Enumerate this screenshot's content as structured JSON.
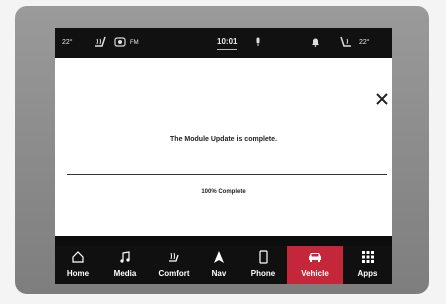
{
  "status_bar": {
    "temp_left": "22°",
    "radio_band": "FM",
    "clock": "10:01",
    "temp_right": "22°"
  },
  "dialog": {
    "message": "The Module Update is complete.",
    "progress_text": "100% Complete",
    "progress_percent": 100
  },
  "nav": {
    "items": [
      {
        "label": "Home",
        "icon": "home-icon"
      },
      {
        "label": "Media",
        "icon": "music-note-icon"
      },
      {
        "label": "Comfort",
        "icon": "seat-heat-icon"
      },
      {
        "label": "Nav",
        "icon": "navigation-arrow-icon"
      },
      {
        "label": "Phone",
        "icon": "phone-icon"
      },
      {
        "label": "Vehicle",
        "icon": "car-icon",
        "active": true
      },
      {
        "label": "Apps",
        "icon": "apps-grid-icon"
      }
    ]
  },
  "colors": {
    "active_tab": "#c4263a",
    "screen_bg": "#0d0d0d",
    "panel_bg": "#ffffff"
  }
}
